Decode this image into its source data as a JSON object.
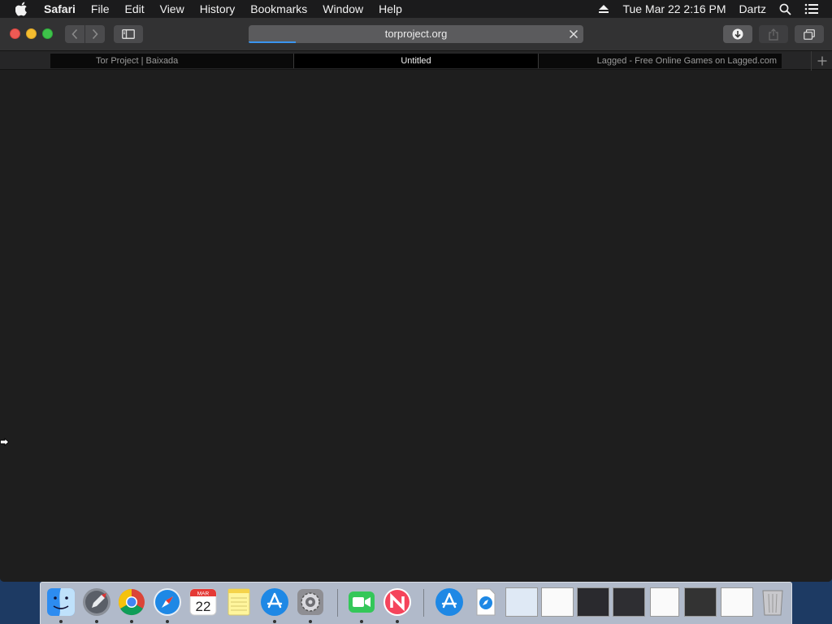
{
  "menubar": {
    "app_name": "Safari",
    "menus": [
      "File",
      "Edit",
      "View",
      "History",
      "Bookmarks",
      "Window",
      "Help"
    ],
    "datetime": "Tue Mar 22  2:16 PM",
    "user": "Dartz"
  },
  "toolbar": {
    "url": "torproject.org",
    "load_progress": 0.14
  },
  "tabs": [
    {
      "title": "Tor Project | Baixada",
      "active": false
    },
    {
      "title": "Untitled",
      "active": true
    },
    {
      "title": "Lagged - Free Online Games on Lagged.com",
      "active": false
    }
  ],
  "dock": {
    "calendar_month": "MAR",
    "calendar_day": "22",
    "apps": [
      "finder-icon",
      "launchpad-icon",
      "chrome-icon",
      "safari-icon",
      "calendar-icon",
      "notes-icon",
      "app-store-icon",
      "system-preferences-icon",
      "facetime-icon",
      "news-icon"
    ],
    "stack_items": [
      "app-store-downloads-icon",
      "safari-download-icon"
    ],
    "trash": "trash-icon"
  },
  "colors": {
    "window_bg": "#1e1e1e",
    "toolbar_bg": "#323233",
    "accent": "#3a95f0",
    "desktop": "#1d3a63"
  }
}
